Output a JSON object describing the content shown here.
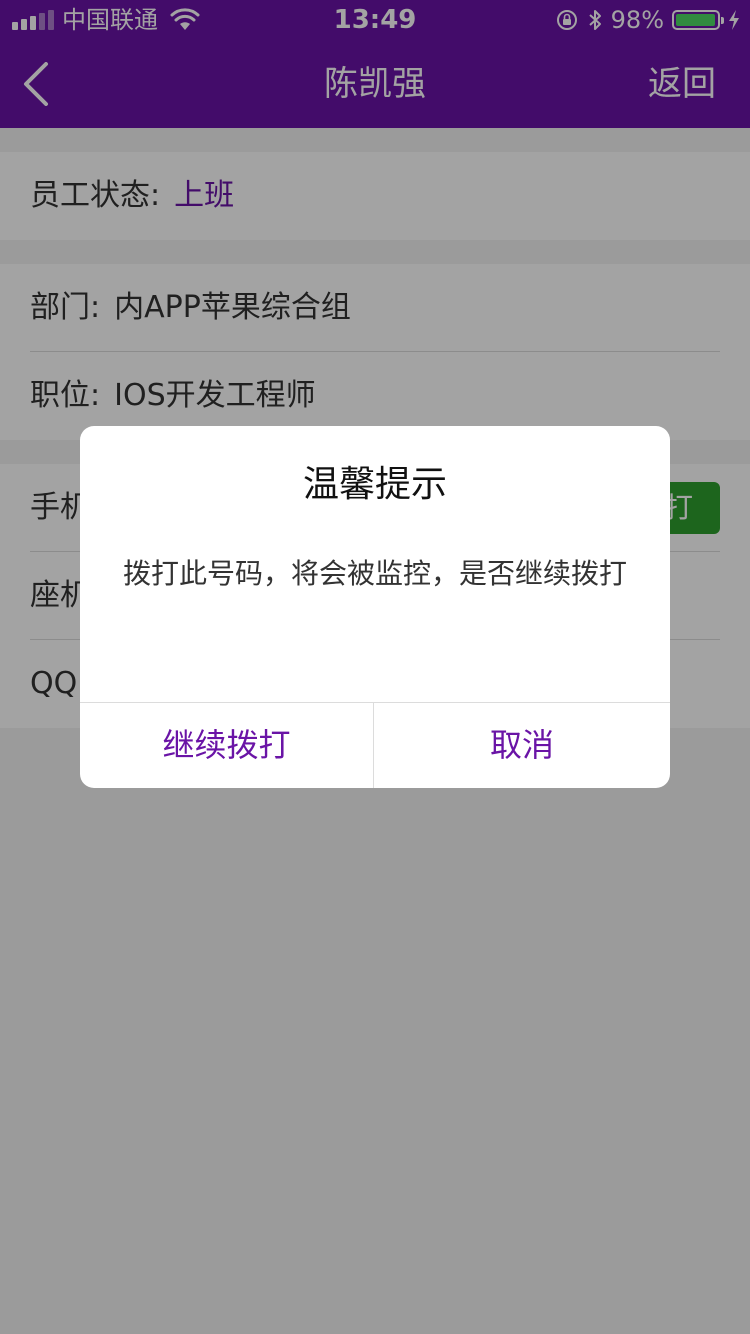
{
  "status_bar": {
    "carrier": "中国联通",
    "time": "13:49",
    "battery": "98%",
    "battery_level": 0.98
  },
  "nav": {
    "title": "陈凯强",
    "return_label": "返回",
    "back_icon": "chevron-left-icon"
  },
  "employee_status": {
    "label": "员工状态:",
    "value": "上班"
  },
  "info": {
    "department_label": "部门:",
    "department_value": "内APP苹果综合组",
    "position_label": "职位:",
    "position_value": "IOS开发工程师"
  },
  "contacts": {
    "mobile_label": "手机",
    "call_button": "拨打",
    "landline_label": "座机",
    "qq_label": "QQ"
  },
  "dialog": {
    "title": "温馨提示",
    "message": "拨打此号码，将会被监控，是否继续拨打",
    "confirm_label": "继续拨打",
    "cancel_label": "取消"
  },
  "colors": {
    "brand_purple": "#6a14a6",
    "call_green": "#2e9e2e",
    "battery_green": "#4cd964"
  }
}
